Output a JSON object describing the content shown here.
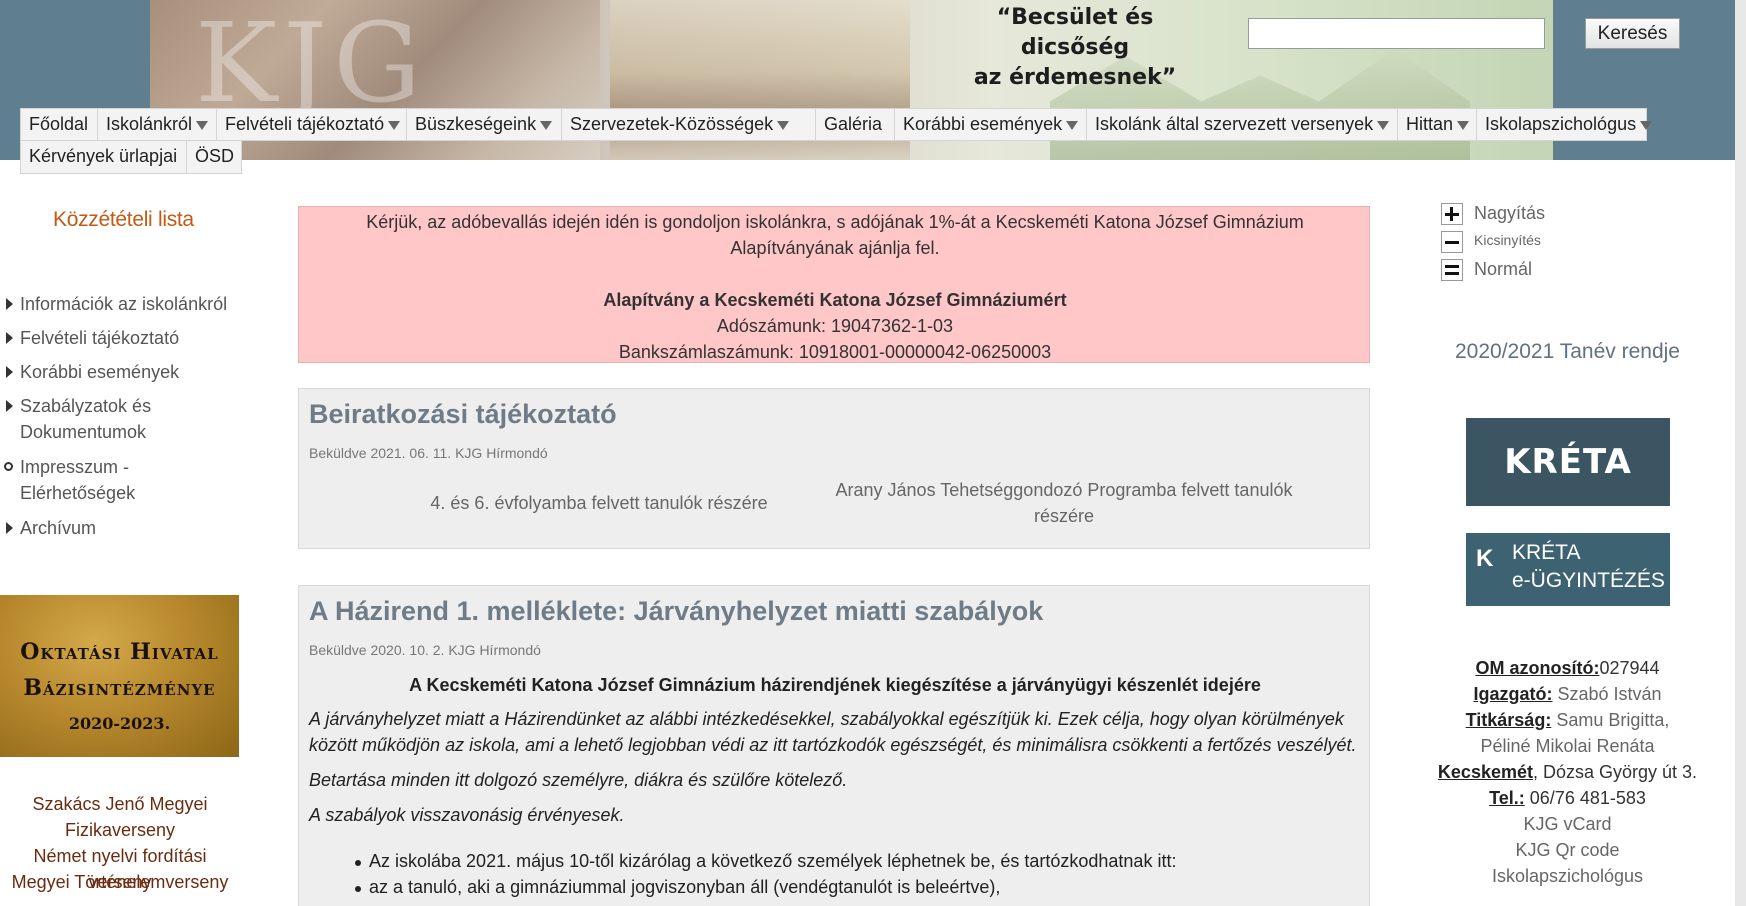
{
  "header": {
    "banner_letters": "KJG",
    "motto_line1": "“Becsület és dicsőség",
    "motto_line2": "az érdemesnek”",
    "search": {
      "placeholder": "",
      "button": "Keresés"
    }
  },
  "nav": [
    {
      "label": "Főoldal",
      "arrow": false
    },
    {
      "label": "Iskolánkról",
      "arrow": true
    },
    {
      "label": "Felvételi tájékoztató",
      "arrow": true
    },
    {
      "label": "Büszkeségeink",
      "arrow": true
    },
    {
      "label": "Szervezetek-Közösségek",
      "arrow": true
    },
    {
      "label": "Galéria",
      "arrow": false
    },
    {
      "label": "Korábbi események",
      "arrow": true
    },
    {
      "label": "Iskolánk által szervezett versenyek",
      "arrow": true
    },
    {
      "label": "Hittan",
      "arrow": true
    },
    {
      "label": "Iskolapszichológus",
      "arrow": true
    },
    {
      "label": "Kérvények ürlapjai",
      "arrow": false
    },
    {
      "label": "ÖSD",
      "arrow": false
    }
  ],
  "left_sidebar": {
    "title": "Közzétételi lista",
    "items": [
      {
        "label": "Információk az iskolánkról",
        "marker": "triangle"
      },
      {
        "label": "Felvételi tájékoztató",
        "marker": "triangle"
      },
      {
        "label": "Korábbi események",
        "marker": "triangle"
      },
      {
        "label": "Szabályzatok és Dokumentumok",
        "marker": "triangle"
      },
      {
        "label": "Impresszum - Elérhetőségek",
        "marker": "circle"
      },
      {
        "label": "Archívum",
        "marker": "triangle"
      }
    ],
    "badge": {
      "line1": "Oktatási Hivatal",
      "line2": "Bázisintézménye",
      "line3": "2020-2023."
    },
    "links": [
      "Szakács Jenő Megyei",
      "Fizikaverseny",
      "Német nyelvi fordítási verseny",
      "Megyei Történelemverseny"
    ]
  },
  "donation": {
    "text": "Kérjük, az adóbevallás idején idén is gondoljon iskolánkra, s adójának 1%-át a Kecskeméti Katona József Gimnázium Alapítványának ajánlja fel.",
    "foundation": "Alapítvány a Kecskeméti Katona József Gimnáziumért",
    "tax_number": "Adószámunk: 19047362-1-03",
    "bank_account": "Bankszámlaszámunk: 10918001-00000042-06250003"
  },
  "articles": [
    {
      "title": "Beiratkozási tájékoztató",
      "meta": "Beküldve 2021. 06. 11. KJG Hírmondó",
      "col1": "4. és 6. évfolyamba felvett tanulók részére",
      "col2": "Arany János Tehetséggondozó Programba felvett tanulók részére"
    },
    {
      "title": "A Házirend 1. melléklete: Járványhelyzet miatti szabályok",
      "meta": "Beküldve 2020. 10. 2. KJG Hírmondó",
      "heading": "A Kecskeméti Katona József Gimnázium házirendjének kiegészítése a járványügyi készenlét idejére",
      "para1": "A járványhelyzet miatt a Házirendünket az alábbi intézkedésekkel, szabályokkal egészítjük ki. Ezek célja, hogy olyan körülmények között működjön az iskola, ami a lehető legjobban védi az itt tartózkodók egészségét, és minimálisra csökkenti a fertőzés veszélyét.",
      "para2": "Betartása minden itt dolgozó személyre, diákra és szülőre kötelező.",
      "para3": "A szabályok visszavonásig érvényesek.",
      "bullets": [
        "Az iskolába 2021. május 10-től kizárólag a következő személyek léphetnek be, és tartózkodhatnak itt:",
        "az a tanuló, aki a gimnáziummal jogviszonyban áll (vendégtanulót is beleértve),"
      ]
    }
  ],
  "right_sidebar": {
    "zoom": {
      "zoom_in": "Nagyítás",
      "zoom_out": "Kicsinyítés",
      "normal": "Normál"
    },
    "tanev": "2020/2021 Tanév rendje",
    "kreta1": "KRÉTA",
    "kreta2": {
      "icon": "K",
      "line1": "KRÉTA",
      "line2": "e-ÜGYINTÉZÉS"
    },
    "contact": {
      "om_label": "OM azonosító:",
      "om_value": "027944",
      "director_label": "Igazgató:",
      "director_value": "Szabó István",
      "secretary_label": "Titkárság:",
      "secretary_value": "Samu Brigitta,",
      "secretary_value2": "Péliné Mikolai Renáta",
      "city_label": "Kecskemét",
      "address": ", Dózsa György út 3.",
      "phone_label": "Tel.:",
      "phone_value": "06/76 481-583",
      "vcard": "KJG vCard",
      "qr": "KJG Qr code",
      "psych": "Iskolapszichológus"
    }
  },
  "colors": {
    "header_bg": "#5f7f90",
    "donation_bg": "#ffc7c7",
    "article_bg": "#eeeeee",
    "title_color": "#6f7b86",
    "kozzet_color": "#c15a14",
    "kreta_bg": "#3b5562"
  }
}
